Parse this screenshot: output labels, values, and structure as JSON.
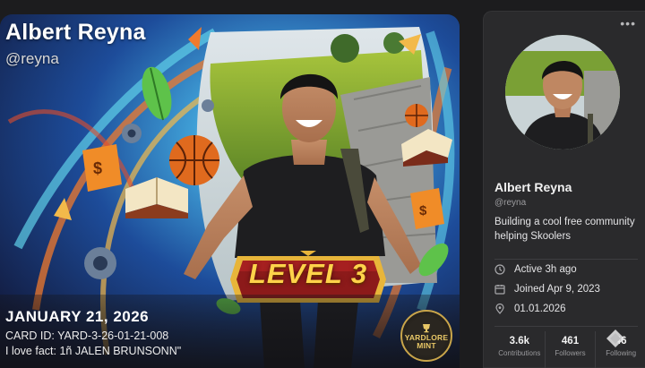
{
  "card": {
    "name": "Albert Reyna",
    "handle": "@reyna",
    "level_label": "LEVEL 3",
    "date": "JANUARY 21, 2026",
    "card_id": "CARD ID: YARD-3-26-01-21-008",
    "fact": "I love fact: 1ñ JALEN BRUNSONN\"",
    "mint_lines": [
      "YARDLORE",
      "MINT"
    ]
  },
  "profile": {
    "more_label": "•••",
    "name": "Albert Reyna",
    "handle": "@reyna",
    "bio": "Building a cool free community helping Skoolers",
    "meta": [
      {
        "icon": "clock-icon",
        "text": "Active 3h ago"
      },
      {
        "icon": "calendar-icon",
        "text": "Joined Apr 9, 2023"
      },
      {
        "icon": "location-pin-icon",
        "text": "01.01.2026"
      }
    ],
    "stats": [
      {
        "value": "3.6k",
        "label": "Contributions"
      },
      {
        "value": "461",
        "label": "Followers"
      },
      {
        "value": "46",
        "label": "Following"
      }
    ]
  },
  "colors": {
    "background": "#1c1c1e",
    "panel": "#2a2a2c",
    "level_gold": "#ffd34a",
    "level_red": "#8c1a1a",
    "mint_gold": "#c9a54a"
  }
}
